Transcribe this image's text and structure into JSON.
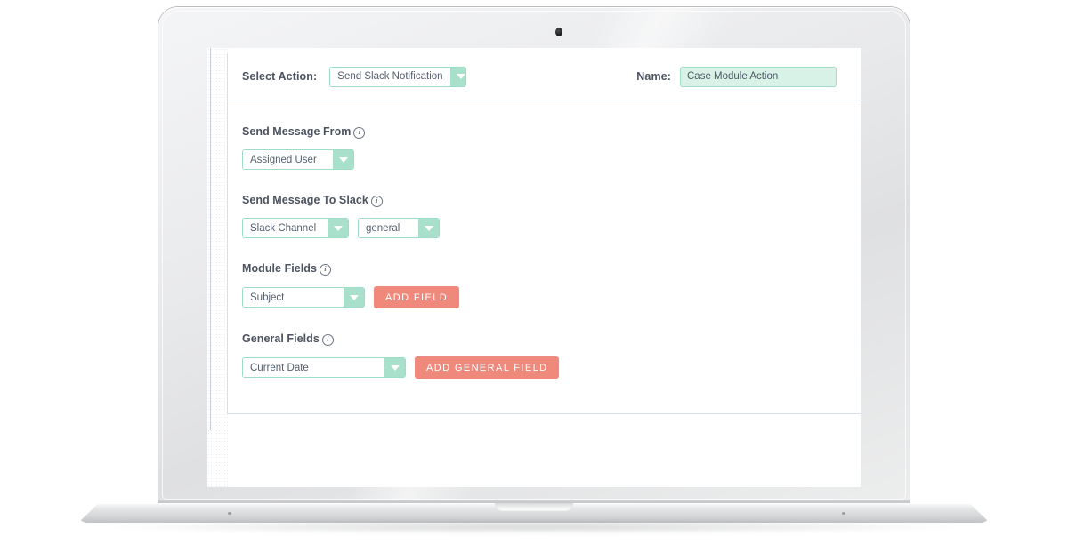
{
  "device": {
    "type": "laptop-mockup",
    "webcam": "webcam-dot"
  },
  "header": {
    "select_action_label": "Select Action:",
    "action_value": "Send Slack Notification",
    "name_label": "Name:",
    "name_value": "Case Module Action",
    "close_icon": "close-icon",
    "close_glyph": "✖"
  },
  "info_icon_glyph": "i",
  "sections": [
    {
      "key": "send_message_from",
      "title": "Send Message From",
      "has_info": true,
      "controls": [
        {
          "kind": "select",
          "name": "send-message-from-select",
          "value": "Assigned User"
        }
      ]
    },
    {
      "key": "send_message_to_slack",
      "title": "Send Message To Slack",
      "has_info": true,
      "controls": [
        {
          "kind": "select",
          "name": "slack-target-type-select",
          "value": "Slack Channel"
        },
        {
          "kind": "select",
          "name": "slack-channel-select",
          "value": "general"
        }
      ]
    },
    {
      "key": "module_fields",
      "title": "Module Fields",
      "has_info": true,
      "controls": [
        {
          "kind": "select",
          "name": "module-field-select",
          "value": "Subject"
        },
        {
          "kind": "button",
          "name": "add-field-button",
          "value": "ADD FIELD"
        }
      ]
    },
    {
      "key": "general_fields",
      "title": "General Fields",
      "has_info": true,
      "controls": [
        {
          "kind": "select",
          "name": "general-field-select",
          "value": "Current Date"
        },
        {
          "kind": "button",
          "name": "add-general-field-button",
          "value": "ADD GENERAL FIELD"
        }
      ]
    }
  ],
  "colors": {
    "mint_border": "#9fdcc6",
    "mint_fill": "#a8e0cb",
    "name_field_fill": "#d9f2e7",
    "coral": "#ef897c",
    "text": "#4c5360",
    "divider": "#d5dde7"
  }
}
